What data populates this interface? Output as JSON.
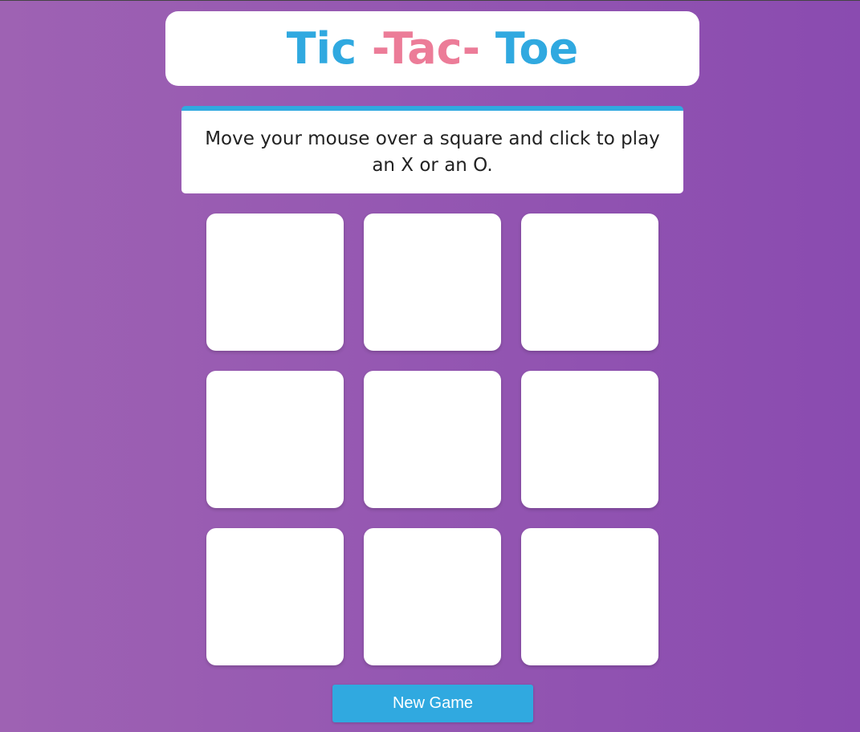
{
  "title": {
    "part1": "Tic",
    "part2": " -Tac- ",
    "part3": "Toe"
  },
  "instructions": "Move your mouse over a square and click to play an X or an O.",
  "board": {
    "cells": [
      "",
      "",
      "",
      "",
      "",
      "",
      "",
      "",
      ""
    ]
  },
  "new_game_label": "New Game",
  "colors": {
    "blue": "#30a9e0",
    "pink": "#ec7c98",
    "background_start": "#9e62b3",
    "background_end": "#8a4bb0"
  }
}
